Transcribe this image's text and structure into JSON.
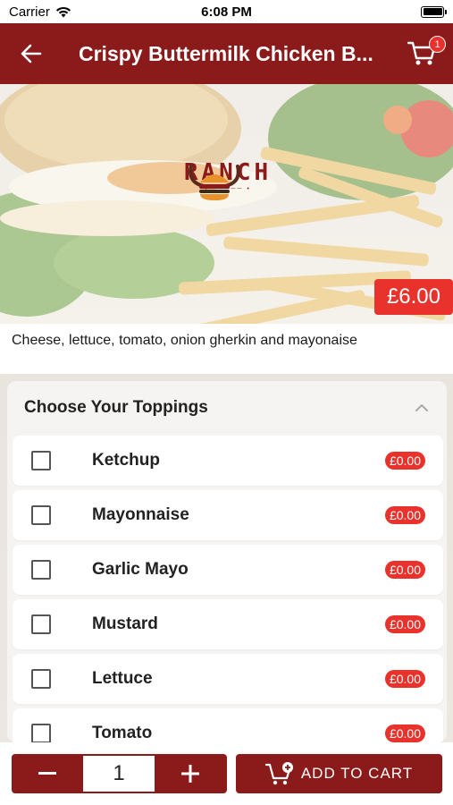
{
  "status": {
    "carrier": "Carrier",
    "time": "6:08 PM"
  },
  "nav": {
    "title": "Crispy Buttermilk Chicken B...",
    "cart_count": "1"
  },
  "hero": {
    "logo_text": "RANCH",
    "price": "£6.00"
  },
  "description": "Cheese, lettuce, tomato, onion gherkin and mayonaise",
  "toppings": {
    "title": "Choose Your Toppings",
    "items": [
      {
        "name": "Ketchup",
        "price": "£0.00"
      },
      {
        "name": "Mayonnaise",
        "price": "£0.00"
      },
      {
        "name": "Garlic Mayo",
        "price": "£0.00"
      },
      {
        "name": "Mustard",
        "price": "£0.00"
      },
      {
        "name": "Lettuce",
        "price": "£0.00"
      },
      {
        "name": "Tomato",
        "price": "£0.00"
      }
    ]
  },
  "bottom": {
    "quantity": "1",
    "add_to_cart": "ADD TO CART"
  },
  "colors": {
    "brand": "#8b1a1a",
    "price_badge": "#e8322b"
  }
}
